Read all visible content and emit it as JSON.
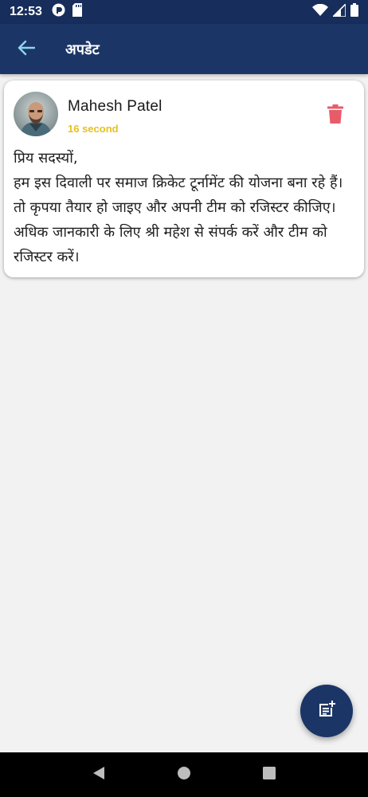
{
  "status_bar": {
    "time": "12:53",
    "icons_left": [
      "pocketcasts-icon",
      "sd-card-icon"
    ],
    "icons_right": [
      "wifi-icon",
      "signal-icon",
      "battery-icon"
    ]
  },
  "app_bar": {
    "title": "अपडेट",
    "back_icon": "arrow-left-icon",
    "background": "#1b3666"
  },
  "update": {
    "author": "Mahesh Patel",
    "time": "16 second",
    "message": "प्रिय सदस्यों,\nहम इस दिवाली पर समाज क्रिकेट टूर्नामेंट की योजना बना रहे हैं। तो कृपया तैयार हो जाइए और अपनी टीम को रजिस्टर कीजिए। अधिक जानकारी के लिए श्री महेश से संपर्क करें और टीम को रजिस्टर करें।",
    "delete_icon": "trash-icon",
    "time_color": "#e6c11f",
    "delete_color": "#e85c6a"
  },
  "fab": {
    "icon": "add-note-icon"
  },
  "nav_bar": {
    "icons": [
      "back-triangle-icon",
      "home-circle-icon",
      "recents-square-icon"
    ]
  }
}
